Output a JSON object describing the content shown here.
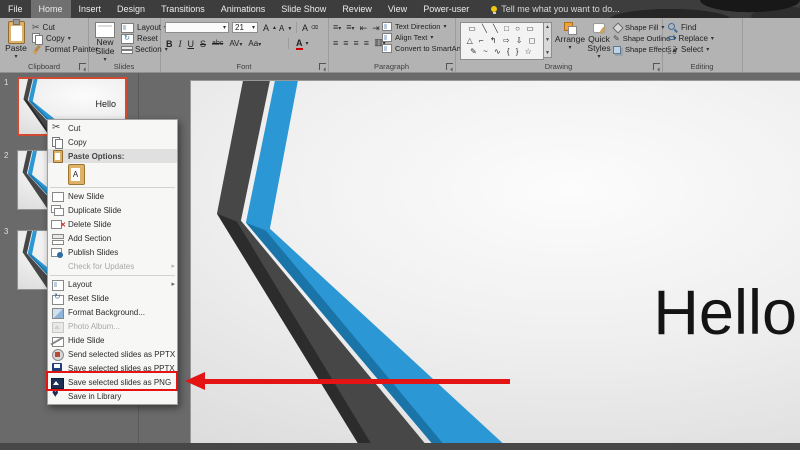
{
  "titlebar": {
    "tell_me": "Tell me what you want to do..."
  },
  "tabs": {
    "file": "File",
    "home": "Home",
    "insert": "Insert",
    "design": "Design",
    "transitions": "Transitions",
    "animations": "Animations",
    "slideshow": "Slide Show",
    "review": "Review",
    "view": "View",
    "poweruser": "Power-user"
  },
  "ribbon": {
    "clipboard": {
      "group": "Clipboard",
      "paste": "Paste",
      "cut": "Cut",
      "copy": "Copy",
      "format_painter": "Format Painter"
    },
    "slides": {
      "group": "Slides",
      "new_slide": "New Slide",
      "layout": "Layout",
      "reset": "Reset",
      "section": "Section"
    },
    "font": {
      "group": "Font",
      "font_name": "",
      "size": "21",
      "grow": "A",
      "shrink": "A",
      "clear": "A",
      "bold": "B",
      "italic": "I",
      "underline": "U",
      "strike": "S",
      "abc": "abc",
      "av": "AV",
      "aa": "Aa",
      "color_a": "A"
    },
    "paragraph": {
      "group": "Paragraph",
      "text_direction": "Text Direction",
      "align_text": "Align Text",
      "smartart": "Convert to SmartArt"
    },
    "drawing": {
      "group": "Drawing",
      "arrange": "Arrange",
      "quick_styles": "Quick Styles",
      "shape_fill": "Shape Fill",
      "shape_outline": "Shape Outline",
      "shape_effects": "Shape Effects",
      "shapes_row1": "▭ ╲ ╲ □ ○ ▭",
      "shapes_row2": "△ ⌐ ↰ ⇨ ⇩ ◻",
      "shapes_row3": "✎ ~ ∿ { } ☆"
    },
    "editing": {
      "group": "Editing",
      "find": "Find",
      "replace": "Replace",
      "select": "Select"
    }
  },
  "slide_panel": {
    "slide1_number": "1",
    "slide1_title": "Hello",
    "slide2_number": "2",
    "slide3_number": "3"
  },
  "context_menu": {
    "items": [
      {
        "label": "Cut",
        "icon": "scissors"
      },
      {
        "label": "Copy",
        "icon": "copy"
      },
      {
        "label": "Paste Options:",
        "icon": "clipboard"
      },
      {
        "label": "",
        "icon": "paste-keep-source-formatting"
      },
      {
        "label": "New Slide",
        "icon": "new-slide"
      },
      {
        "label": "Duplicate Slide",
        "icon": "duplicate"
      },
      {
        "label": "Delete Slide",
        "icon": "delete"
      },
      {
        "label": "Add Section",
        "icon": "section"
      },
      {
        "label": "Publish Slides",
        "icon": "publish"
      },
      {
        "label": "Check for Updates",
        "icon": "",
        "disabled": true,
        "submenu": true
      },
      {
        "label": "Layout",
        "icon": "layout",
        "submenu": true
      },
      {
        "label": "Reset Slide",
        "icon": "reset"
      },
      {
        "label": "Format Background...",
        "icon": "background"
      },
      {
        "label": "Photo Album...",
        "icon": "photo",
        "disabled": true
      },
      {
        "label": "Hide Slide",
        "icon": "hide"
      },
      {
        "label": "Send selected slides as PPTX",
        "icon": "send"
      },
      {
        "label": "Save selected slides as PPTX",
        "icon": "save"
      },
      {
        "label": "Save selected slides as PNG",
        "icon": "picture",
        "annotated": true
      },
      {
        "label": "Save in Library",
        "icon": "heart"
      }
    ]
  },
  "slide": {
    "title": "Hello"
  },
  "colors": {
    "accent_blue": "#2b97d4",
    "band_dark": "#474747",
    "annotation_red": "#e51414",
    "selected_thumb_border": "#cf4a30",
    "ribbon_bg": "#b3b3b3",
    "tabbar_bg": "#3d3d3d"
  }
}
